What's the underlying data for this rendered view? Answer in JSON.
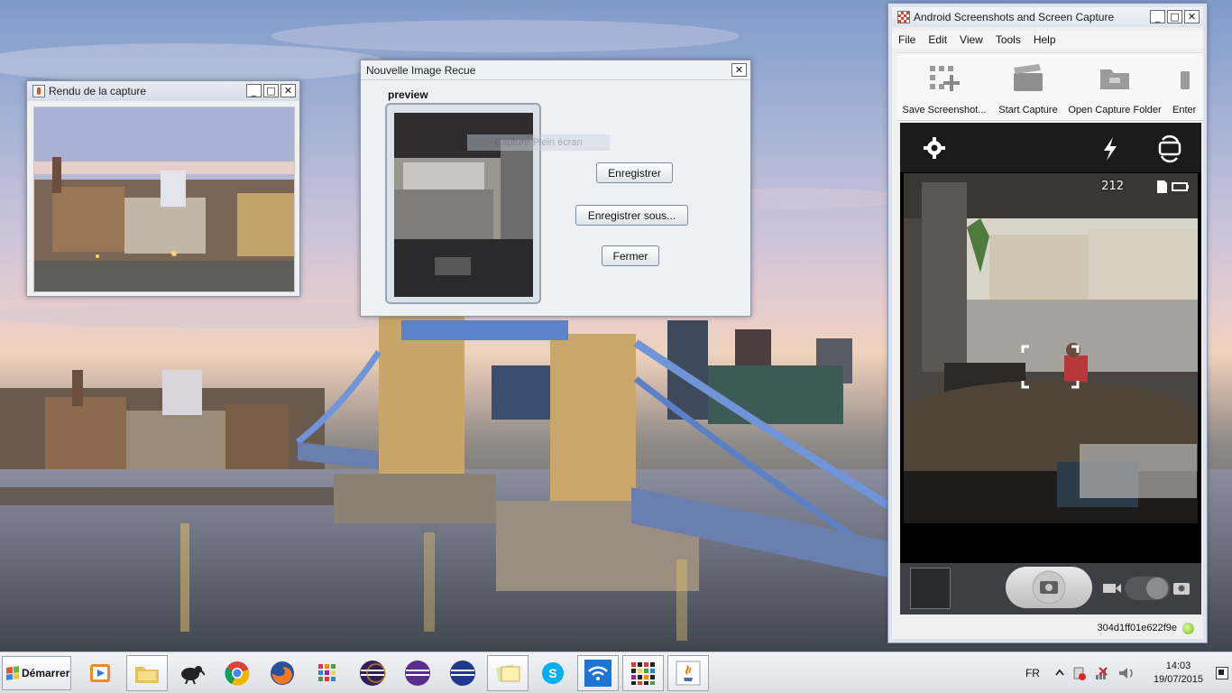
{
  "desktop": {
    "description_none": ""
  },
  "rendu_window": {
    "title": "Rendu de la capture",
    "minimize": "_",
    "maximize": "□",
    "close": "✕"
  },
  "dialog": {
    "title": "Nouvelle Image Recue",
    "close": "✕",
    "preview_label": "preview",
    "ghost_text": "Capture Plein écran",
    "buttons": {
      "save": "Enregistrer",
      "save_as": "Enregistrer sous...",
      "close": "Fermer"
    }
  },
  "android_app": {
    "title": "Android Screenshots and Screen Capture",
    "minimize": "_",
    "maximize": "□",
    "close": "✕",
    "menu": [
      "File",
      "Edit",
      "View",
      "Tools",
      "Help"
    ],
    "toolbar": {
      "save_screenshot": "Save Screenshot...",
      "start_capture": "Start Capture",
      "open_folder": "Open Capture Folder",
      "enter": "Enter"
    },
    "phone": {
      "shots_remaining": "212",
      "icons": [
        "gear-icon",
        "flash-icon",
        "switch-camera-icon",
        "sd-card-icon",
        "battery-icon",
        "camera-icon",
        "video-icon"
      ]
    },
    "device_id": "304d1ff01e622f9e"
  },
  "taskbar": {
    "start_label": "Démarrer",
    "language": "FR",
    "time": "14:03",
    "date": "19/07/2015",
    "apps": [
      "media-player-icon",
      "file-explorer-icon",
      "kiwi-icon",
      "chrome-icon",
      "firefox-icon",
      "apps-grid-icon",
      "eclipse-icon",
      "eclipse-purple-icon",
      "eclipse-blue-icon",
      "image-viewer-icon",
      "skype-icon",
      "wifi-icon",
      "palette-icon",
      "java-icon"
    ]
  },
  "colors": {
    "accent": "#1e73d6",
    "desktop_sky": "#a3b1d4"
  }
}
